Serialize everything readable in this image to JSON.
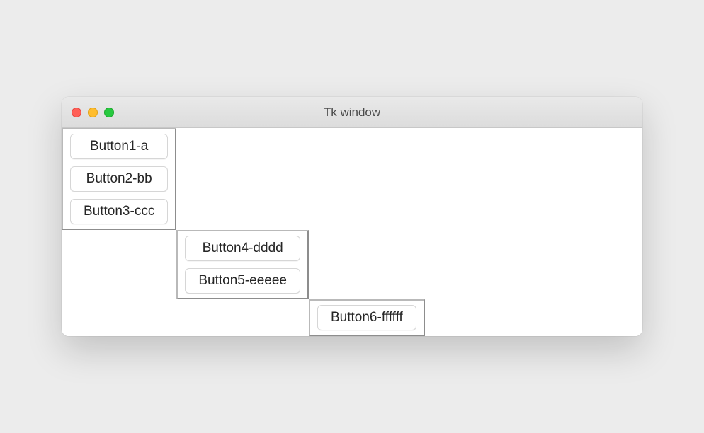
{
  "window": {
    "title": "Tk window"
  },
  "frames": {
    "frame1": {
      "button1": "Button1-a",
      "button2": "Button2-bb",
      "button3": "Button3-ccc"
    },
    "frame2": {
      "button4": "Button4-dddd",
      "button5": "Button5-eeeee"
    },
    "frame3": {
      "button6": "Button6-ffffff"
    }
  }
}
